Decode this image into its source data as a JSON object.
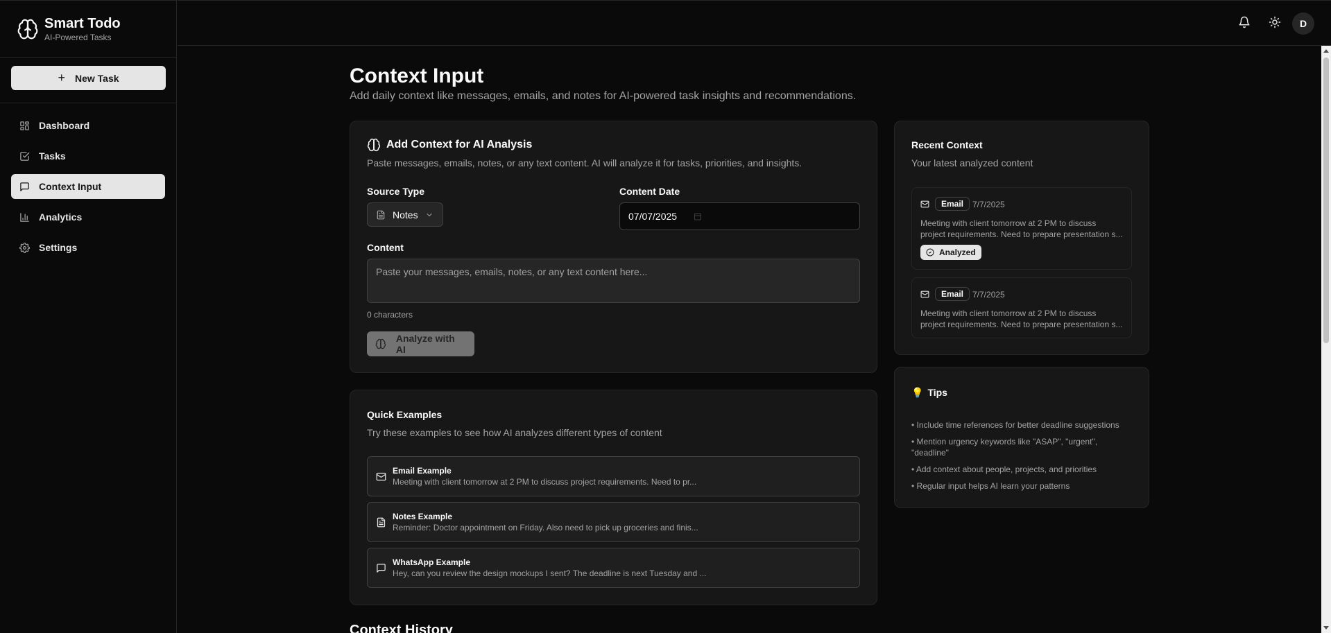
{
  "app": {
    "name": "Smart Todo",
    "tagline": "AI-Powered Tasks"
  },
  "sidebar": {
    "new_task_label": "New Task",
    "items": [
      {
        "label": "Dashboard",
        "icon": "layout-grid-icon",
        "active": false
      },
      {
        "label": "Tasks",
        "icon": "check-square-icon",
        "active": false
      },
      {
        "label": "Context Input",
        "icon": "message-square-icon",
        "active": true
      },
      {
        "label": "Analytics",
        "icon": "bar-chart-icon",
        "active": false
      },
      {
        "label": "Settings",
        "icon": "gear-icon",
        "active": false
      }
    ]
  },
  "topbar": {
    "avatar_initial": "D",
    "icons": [
      "bell-icon",
      "sun-icon"
    ]
  },
  "page": {
    "title": "Context Input",
    "subtitle": "Add daily context like messages, emails, and notes for AI-powered task insights and recommendations."
  },
  "add_context": {
    "title": "Add Context for AI Analysis",
    "description": "Paste messages, emails, notes, or any text content. AI will analyze it for tasks, priorities, and insights.",
    "source_type_label": "Source Type",
    "source_type_value": "Notes",
    "content_date_label": "Content Date",
    "content_date_value": "07/07/2025",
    "content_label": "Content",
    "content_placeholder": "Paste your messages, emails, notes, or any text content here...",
    "char_count": "0 characters",
    "analyze_label": "Analyze with AI"
  },
  "quick_examples": {
    "title": "Quick Examples",
    "description": "Try these examples to see how AI analyzes different types of content",
    "items": [
      {
        "title": "Email Example",
        "text": "Meeting with client tomorrow at 2 PM to discuss project requirements. Need to pr...",
        "icon": "mail-icon"
      },
      {
        "title": "Notes Example",
        "text": "Reminder: Doctor appointment on Friday. Also need to pick up groceries and finis...",
        "icon": "file-text-icon"
      },
      {
        "title": "WhatsApp Example",
        "text": "Hey, can you review the design mockups I sent? The deadline is next Tuesday and ...",
        "icon": "message-square-icon"
      }
    ]
  },
  "recent_context": {
    "title": "Recent Context",
    "description": "Your latest analyzed content",
    "items": [
      {
        "badge": "Email",
        "date": "7/7/2025",
        "text_line1": "Meeting with client tomorrow at 2 PM to discuss",
        "text_line2": "project requirements. Need to prepare presentation s...",
        "status": "Analyzed"
      },
      {
        "badge": "Email",
        "date": "7/7/2025",
        "text_line1": "Meeting with client tomorrow at 2 PM to discuss",
        "text_line2": "project requirements. Need to prepare presentation s..."
      }
    ]
  },
  "tips": {
    "title": "Tips",
    "icon": "lightbulb-icon",
    "items": [
      "• Include time references for better deadline suggestions",
      "• Mention urgency keywords like \"ASAP\", \"urgent\", \"deadline\"",
      "• Add context about people, projects, and priorities",
      "• Regular input helps AI learn your patterns"
    ]
  },
  "history": {
    "title": "Context History"
  }
}
